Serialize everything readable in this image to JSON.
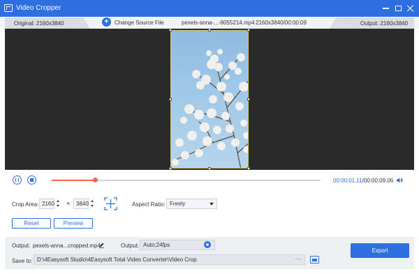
{
  "window": {
    "title": "Video Cropper"
  },
  "info_bar": {
    "original": "Original: 2160x3840",
    "change_source": "Change Source File",
    "filename": "pexels-anna-...-8055214.mp4",
    "resolution_duration": "2160x3840/00:00:09",
    "output": "Output: 2160x3840"
  },
  "playback": {
    "time_current": "00:00:01.11",
    "time_total": "/00:00:09.06",
    "progress": 0.162
  },
  "crop": {
    "label": "Crop Area:",
    "width": "2160",
    "height": "3840",
    "separator": "×",
    "aspect_label": "Aspect Ratio:",
    "aspect_value": "Freely",
    "reset_label": "Reset",
    "preview_label": "Preview"
  },
  "output": {
    "output_label": "Output:",
    "output_filename": "pexels-anna...cropped.mp4",
    "format_label": "Output:",
    "format_value": "Auto;24fps",
    "save_label": "Save to:",
    "save_path": "D:\\4Easysoft Studio\\4Easysoft Total Video Converter\\Video Crop",
    "more_label": "···",
    "export_label": "Export"
  },
  "colors": {
    "accent": "#2d6fe0",
    "progress": "#f06b4f",
    "preview_bg": "#2a2a2a"
  },
  "icons": [
    "app-icon",
    "minimize-icon",
    "maximize-icon",
    "close-icon",
    "plus-circle-icon",
    "pause-icon",
    "stop-icon",
    "speaker-icon",
    "center-crop-icon",
    "chevron-down-icon",
    "edit-icon",
    "gear-icon",
    "folder-icon"
  ]
}
